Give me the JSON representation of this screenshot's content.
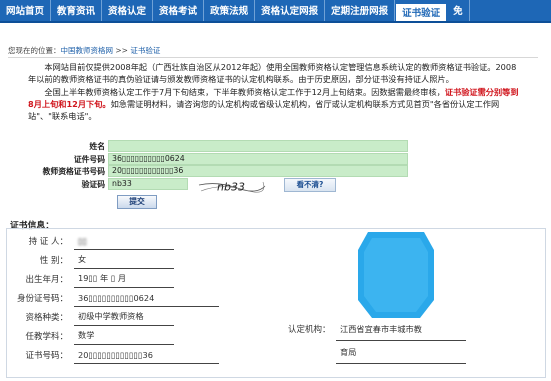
{
  "nav": {
    "items": [
      "网站首页",
      "教育资讯",
      "资格认定",
      "资格考试",
      "政策法规",
      "资格认定网报",
      "定期注册网报",
      "证书验证",
      "免"
    ],
    "active_index": 7
  },
  "breadcrumb": {
    "prefix": "您现在的位置：",
    "home": "中国教师资格网",
    "sep": " >> ",
    "current": "证书验证"
  },
  "notice": {
    "p1": "本网站目前仅提供2008年起（广西壮族自治区从2012年起）使用全国教师资格认定管理信息系统认定的教师资格证书验证。2008年以前的教师资格证书的真伪验证请与颁发教师资格证书的认定机构联系。由于历史原因，部分证书没有持证人照片。",
    "p2_before": "全国上半年教师资格认定工作于7月下旬结束，下半年教师资格认定工作于12月上旬结束。因数据需最终审核，",
    "p2_red": "证书验证需分别等到8月上旬和12月下旬。",
    "p2_after": "如急需证明材料，请咨询您的认定机构或省级认定机构，省厅或认定机构联系方式见首页\"各省份认定工作网站\"、\"联系电话\"。"
  },
  "form": {
    "name_label": "姓名",
    "name_value": "",
    "id_label": "证件号码",
    "id_value": "36▯▯▯▯▯▯▯▯▯▯0624",
    "cert_label": "教师资格证书号码",
    "cert_value": "20▯▯▯▯▯▯▯▯▯▯▯▯36",
    "captcha_label": "验证码",
    "captcha_value": "nb33",
    "captcha_image_text": "nb33",
    "refresh_label": "看不清?",
    "submit_label": "提交"
  },
  "result": {
    "title": "证书信息：",
    "fields": [
      {
        "label": "持 证 人：",
        "value": "▯▯"
      },
      {
        "label": "性   别：",
        "value": "女"
      },
      {
        "label": "出生年月：",
        "value": "19▯▯ 年 ▯ 月"
      },
      {
        "label": "身份证号码：",
        "value": "36▯▯▯▯▯▯▯▯▯▯0624"
      },
      {
        "label": "资格种类：",
        "value": "初级中学教师资格"
      },
      {
        "label": "任教学科：",
        "value": "数学"
      },
      {
        "label": "证书号码：",
        "value": "20▯▯▯▯▯▯▯▯▯▯▯▯36"
      }
    ],
    "org_label": "认定机构：",
    "org_value_line1": "江西省宜春市丰城市教",
    "org_value_line2": "育局"
  },
  "colors": {
    "nav_bg": "#1e67b6",
    "input_bg": "#c9ecc9",
    "red_text": "#d0141c",
    "photo_blue": "#2aa8ea"
  }
}
